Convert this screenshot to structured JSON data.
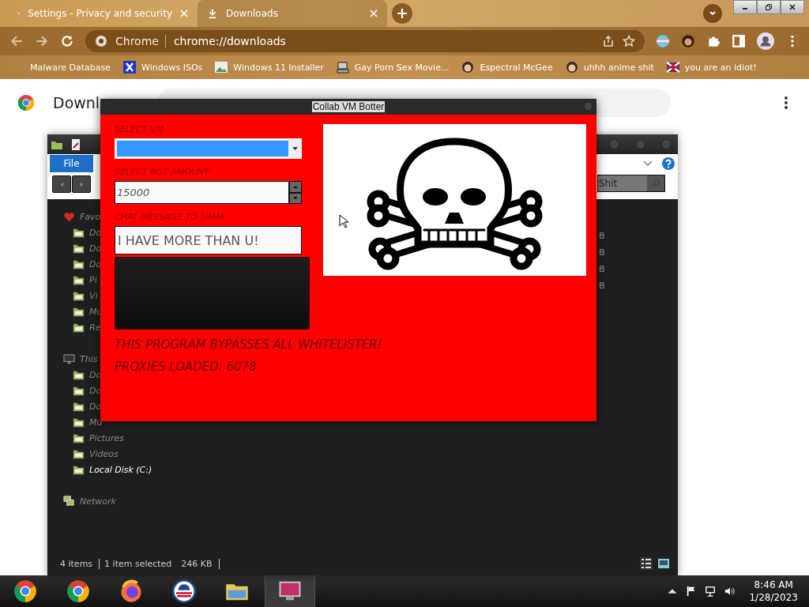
{
  "browser": {
    "tabs": [
      {
        "title": "Settings - Privacy and security",
        "kind": "settings",
        "selected": false
      },
      {
        "title": "Downloads",
        "kind": "download",
        "selected": true
      }
    ],
    "omnibox": {
      "site": "Chrome",
      "url": "chrome://downloads"
    },
    "bookmarks": [
      {
        "label": "Malware Database",
        "kind": "none"
      },
      {
        "label": "Windows ISOs",
        "kind": "x"
      },
      {
        "label": "Windows 11 Installer",
        "kind": "image"
      },
      {
        "label": "Gay Porn Sex Movie...",
        "kind": "computer"
      },
      {
        "label": "Espectral McGee",
        "kind": "avatar"
      },
      {
        "label": "uhhh anime shit",
        "kind": "avatar"
      },
      {
        "label": "you are an idiot!",
        "kind": "flag"
      }
    ]
  },
  "page": {
    "title": "Downl"
  },
  "explorer": {
    "menu_tab": "File",
    "search_value": "Shit",
    "sidebar": [
      {
        "label": "Favo",
        "kind": "heart",
        "children": [
          {
            "label": "Do",
            "selected": false
          },
          {
            "label": "Do",
            "selected": false
          },
          {
            "label": "Do",
            "selected": false
          },
          {
            "label": "Pi",
            "selected": false
          },
          {
            "label": "Vi",
            "selected": false
          },
          {
            "label": "Mu",
            "selected": false
          },
          {
            "label": "Re",
            "selected": false
          }
        ]
      },
      {
        "label": "This",
        "kind": "monitor",
        "children": [
          {
            "label": "Do",
            "selected": false
          },
          {
            "label": "Do",
            "selected": false
          },
          {
            "label": "Do",
            "selected": false
          },
          {
            "label": "Mu",
            "selected": false
          },
          {
            "label": "Pictures",
            "selected": false
          },
          {
            "label": "Videos",
            "selected": false
          },
          {
            "label": "Local Disk (C:)",
            "selected": true
          }
        ]
      },
      {
        "label": "Network",
        "kind": "network"
      }
    ],
    "size_column": [
      "B",
      "B",
      "B",
      "B"
    ],
    "status_bar": [
      "4 items",
      "1 item selected",
      "246 KB"
    ]
  },
  "bot_window": {
    "title": "Collab VM Botter",
    "fields": [
      {
        "kind": "select",
        "label": "SELECT VM"
      },
      {
        "kind": "spinner",
        "label": "SELECT BOT AMOUNT",
        "value": "15000"
      },
      {
        "kind": "text",
        "label": "CHAT MESSAGE TO SPAM",
        "value": "I HAVE MORE THAN U!"
      }
    ],
    "notices": [
      "THIS PROGRAM BYPASSES ALL WHITELISTER!",
      "PROXIES LOADED: 6078"
    ]
  },
  "taskbar": {
    "apps": [
      {
        "kind": "chrome-old",
        "selected": false
      },
      {
        "kind": "chrome",
        "selected": false
      },
      {
        "kind": "firefox",
        "selected": false
      },
      {
        "kind": "circle-logo",
        "selected": false
      },
      {
        "kind": "folder",
        "selected": false
      },
      {
        "kind": "monitor",
        "selected": true
      }
    ],
    "time": "8:46 AM",
    "date": "1/28/2023"
  }
}
